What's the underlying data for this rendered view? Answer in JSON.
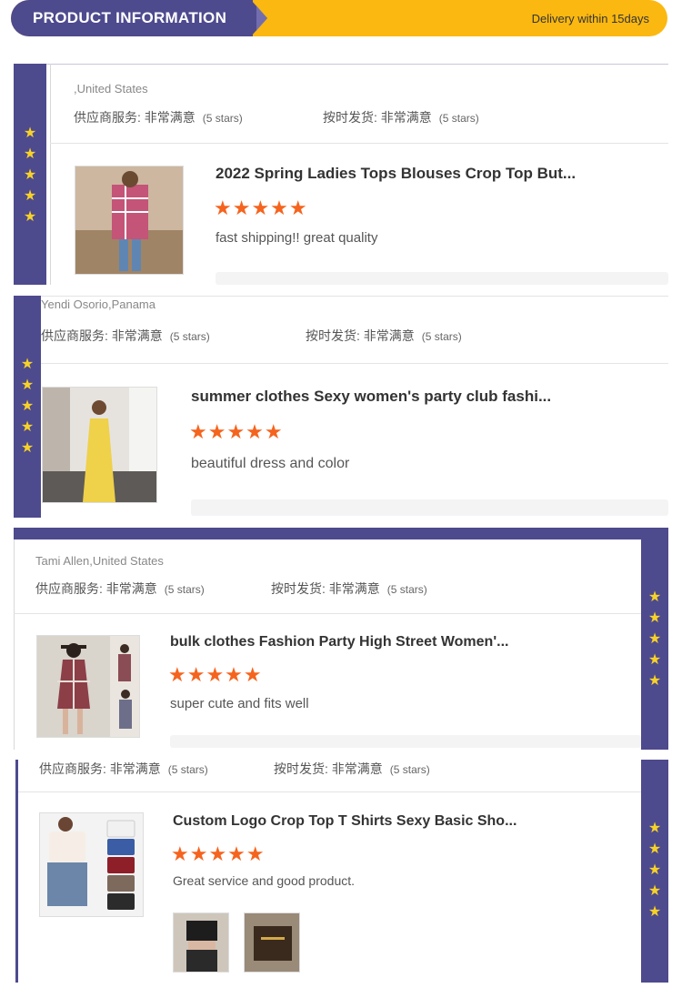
{
  "banner": {
    "title": "PRODUCT INFORMATION",
    "delivery": "Delivery within 15days"
  },
  "colors": {
    "purple": "#4e4a8e",
    "yellow": "#fbb810",
    "star_orange": "#f5641e",
    "side_star": "#f7d227"
  },
  "reviews": [
    {
      "buyer": ",United States",
      "service_label": "供应商服务: 非常满意",
      "service_stars": "(5 stars)",
      "shipping_label": "按时发货: 非常满意",
      "shipping_stars": "(5 stars)",
      "product_title": "2022 Spring Ladies Tops Blouses Crop Top But...",
      "rating": "★★★★★",
      "comment": "fast shipping!! great quality"
    },
    {
      "buyer": "Yendi Osorio,Panama",
      "service_label": "供应商服务: 非常满意",
      "service_stars": "(5 stars)",
      "shipping_label": "按时发货: 非常满意",
      "shipping_stars": "(5 stars)",
      "product_title": "summer clothes Sexy women's party club fashi...",
      "rating": "★★★★★",
      "comment": "beautiful dress and color"
    },
    {
      "buyer": "Tami Allen,United States",
      "service_label": "供应商服务: 非常满意",
      "service_stars": "(5 stars)",
      "shipping_label": "按时发货: 非常满意",
      "shipping_stars": "(5 stars)",
      "product_title": "bulk clothes Fashion Party High Street Women'...",
      "rating": "★★★★★",
      "comment": "super cute and fits well"
    },
    {
      "service_label": "供应商服务: 非常满意",
      "service_stars": "(5 stars)",
      "shipping_label": "按时发货: 非常满意",
      "shipping_stars": "(5 stars)",
      "product_title": "Custom Logo Crop Top T Shirts Sexy Basic Sho...",
      "rating": "★★★★★",
      "comment": "Great service and good product."
    }
  ],
  "side_stars": "★"
}
